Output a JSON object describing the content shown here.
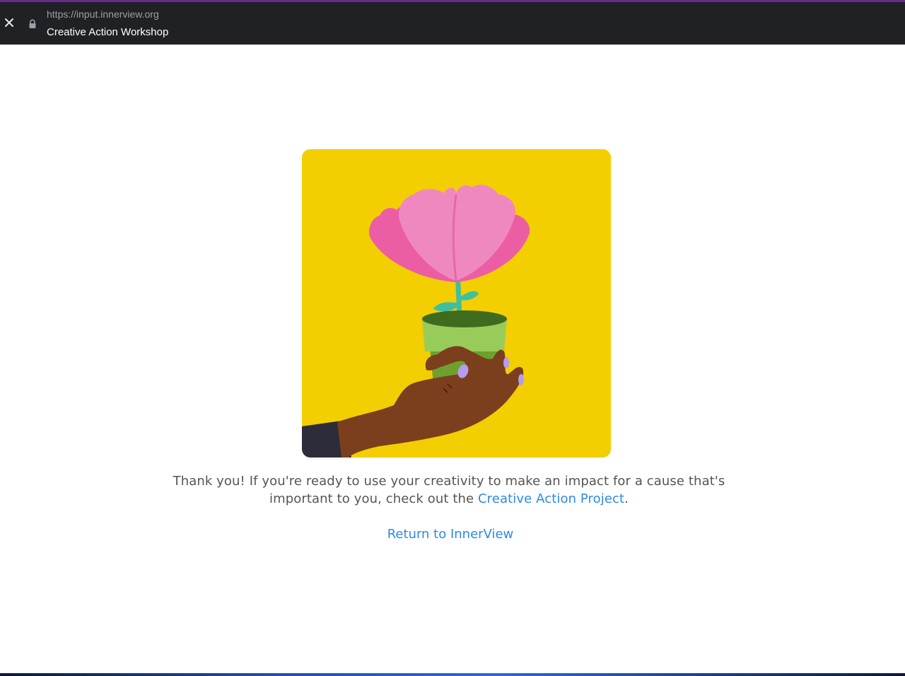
{
  "browser": {
    "url": "https://input.innerview.org",
    "title": "Creative Action Workshop",
    "close_icon": "close-icon",
    "lock_icon": "lock-icon"
  },
  "main": {
    "illustration": {
      "icon": "flower-pot-in-hand-illustration",
      "background_color": "#f3ce00"
    },
    "message_prefix": "Thank you! If you're ready to use your creativity to make an impact for a cause that's important to you, check out the ",
    "message_link": "Creative Action Project",
    "message_suffix": ".",
    "return_link": "Return to InnerView",
    "link_color": "#2b8ae6"
  }
}
